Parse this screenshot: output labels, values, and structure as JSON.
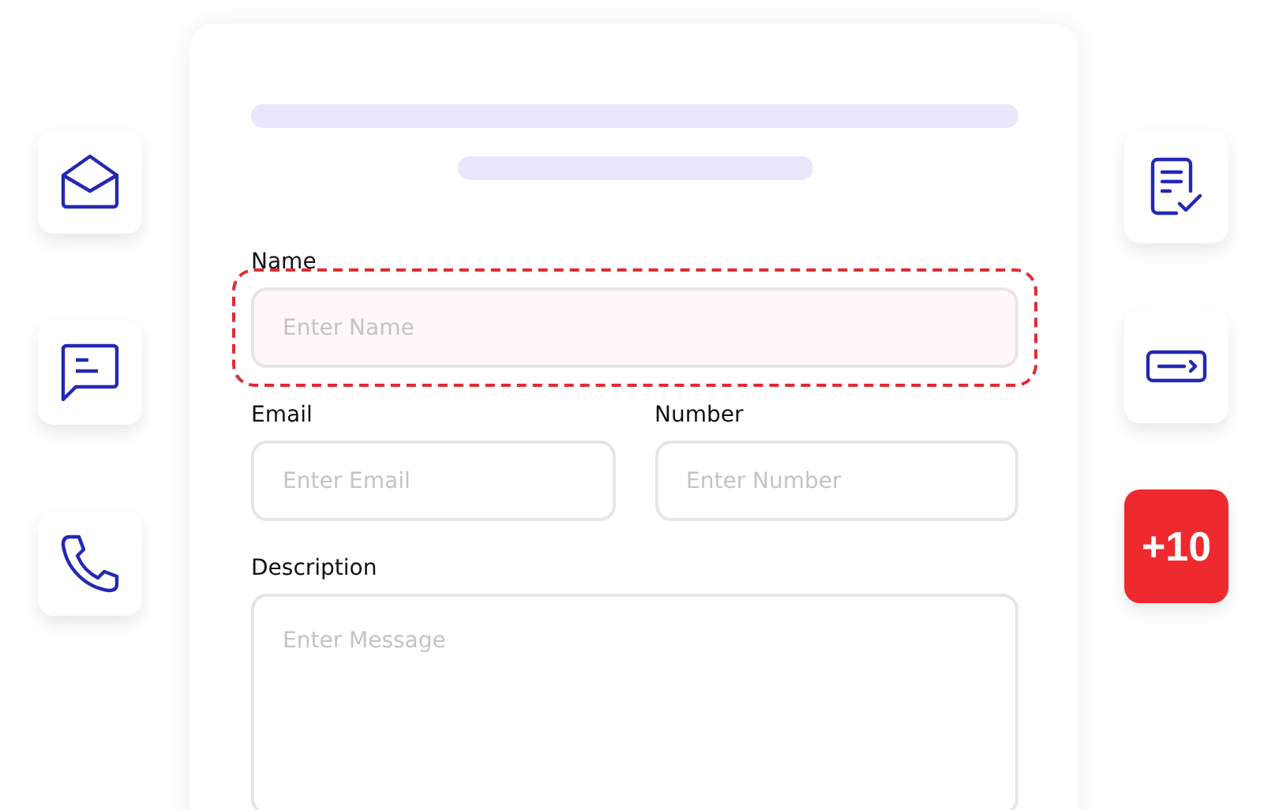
{
  "left_tiles": [
    {
      "kind": "mail"
    },
    {
      "kind": "chat"
    },
    {
      "kind": "phone"
    }
  ],
  "form": {
    "rows": [
      [
        {
          "label": "Name",
          "placeholder": "Enter Name",
          "kind": "input",
          "highlighted": true
        }
      ],
      [
        {
          "label": "Email",
          "placeholder": "Enter Email",
          "kind": "input",
          "highlighted": false
        },
        {
          "label": "Number",
          "placeholder": "Enter Number",
          "kind": "input",
          "highlighted": false
        }
      ],
      [
        {
          "label": "Description",
          "placeholder": "Enter Message",
          "kind": "textarea",
          "highlighted": false
        }
      ]
    ]
  },
  "right_tiles": [
    {
      "kind": "document-check"
    },
    {
      "kind": "card-arrow"
    },
    {
      "kind": "badge",
      "text": "+10"
    }
  ]
}
